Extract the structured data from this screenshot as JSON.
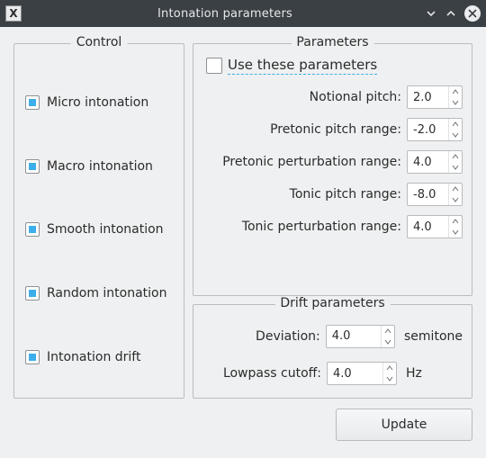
{
  "window": {
    "title": "Intonation parameters",
    "app_icon_letter": "X"
  },
  "control": {
    "title": "Control",
    "items": [
      {
        "label": "Micro intonation",
        "checked": true
      },
      {
        "label": "Macro intonation",
        "checked": true
      },
      {
        "label": "Smooth intonation",
        "checked": true
      },
      {
        "label": "Random intonation",
        "checked": true
      },
      {
        "label": "Intonation drift",
        "checked": true
      }
    ]
  },
  "parameters": {
    "title": "Parameters",
    "use_label": "Use these parameters",
    "use_checked": false,
    "fields": [
      {
        "label": "Notional pitch:",
        "value": "2.0"
      },
      {
        "label": "Pretonic pitch range:",
        "value": "-2.0"
      },
      {
        "label": "Pretonic perturbation range:",
        "value": "4.0"
      },
      {
        "label": "Tonic pitch range:",
        "value": "-8.0"
      },
      {
        "label": "Tonic perturbation range:",
        "value": "4.0"
      }
    ]
  },
  "drift": {
    "title": "Drift parameters",
    "deviation_label": "Deviation:",
    "deviation_value": "4.0",
    "deviation_unit": "semitone",
    "lowpass_label": "Lowpass cutoff:",
    "lowpass_value": "4.0",
    "lowpass_unit": "Hz"
  },
  "buttons": {
    "update": "Update"
  }
}
